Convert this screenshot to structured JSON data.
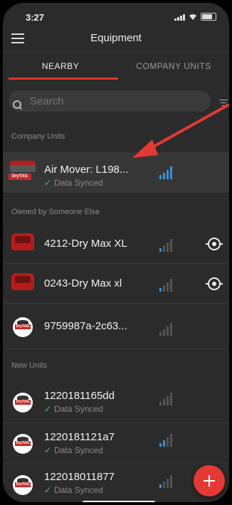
{
  "status_bar": {
    "time": "3:27"
  },
  "header": {
    "title": "Equipment"
  },
  "tabs": [
    {
      "label": "NEARBY",
      "active": true
    },
    {
      "label": "COMPANY UNITS",
      "active": false
    }
  ],
  "search": {
    "placeholder": "Search"
  },
  "sections": {
    "company_units": "Company Units",
    "owned_else": "Owned by Someone Else",
    "new_units": "New Units"
  },
  "rows": [
    {
      "title": "Air Mover: L198...",
      "status": "Data Synced",
      "signal_level": 4,
      "thumb_tag": "DryTAG"
    },
    {
      "title": "4212-Dry Max XL",
      "signal_level": 1
    },
    {
      "title": "0243-Dry Max xl",
      "signal_level": 1
    },
    {
      "title": "9759987a-2c63...",
      "signal_level": 0,
      "thumb_tag": "DryTAG"
    },
    {
      "title": "1220181165dd",
      "status": "Data Synced",
      "signal_level": 0,
      "thumb_tag": "DryTAG"
    },
    {
      "title": "1220181121a7",
      "status": "Data Synced",
      "signal_level": 2,
      "thumb_tag": "DryTAG"
    },
    {
      "title": "122018011877",
      "status": "Data Synced",
      "signal_level": 1,
      "thumb_tag": "DryTAG"
    }
  ],
  "colors": {
    "accent": "#e0342d",
    "signal_active": "#3a8fd6",
    "signal_inactive": "#555555",
    "synced_check": "#4cc04c"
  }
}
